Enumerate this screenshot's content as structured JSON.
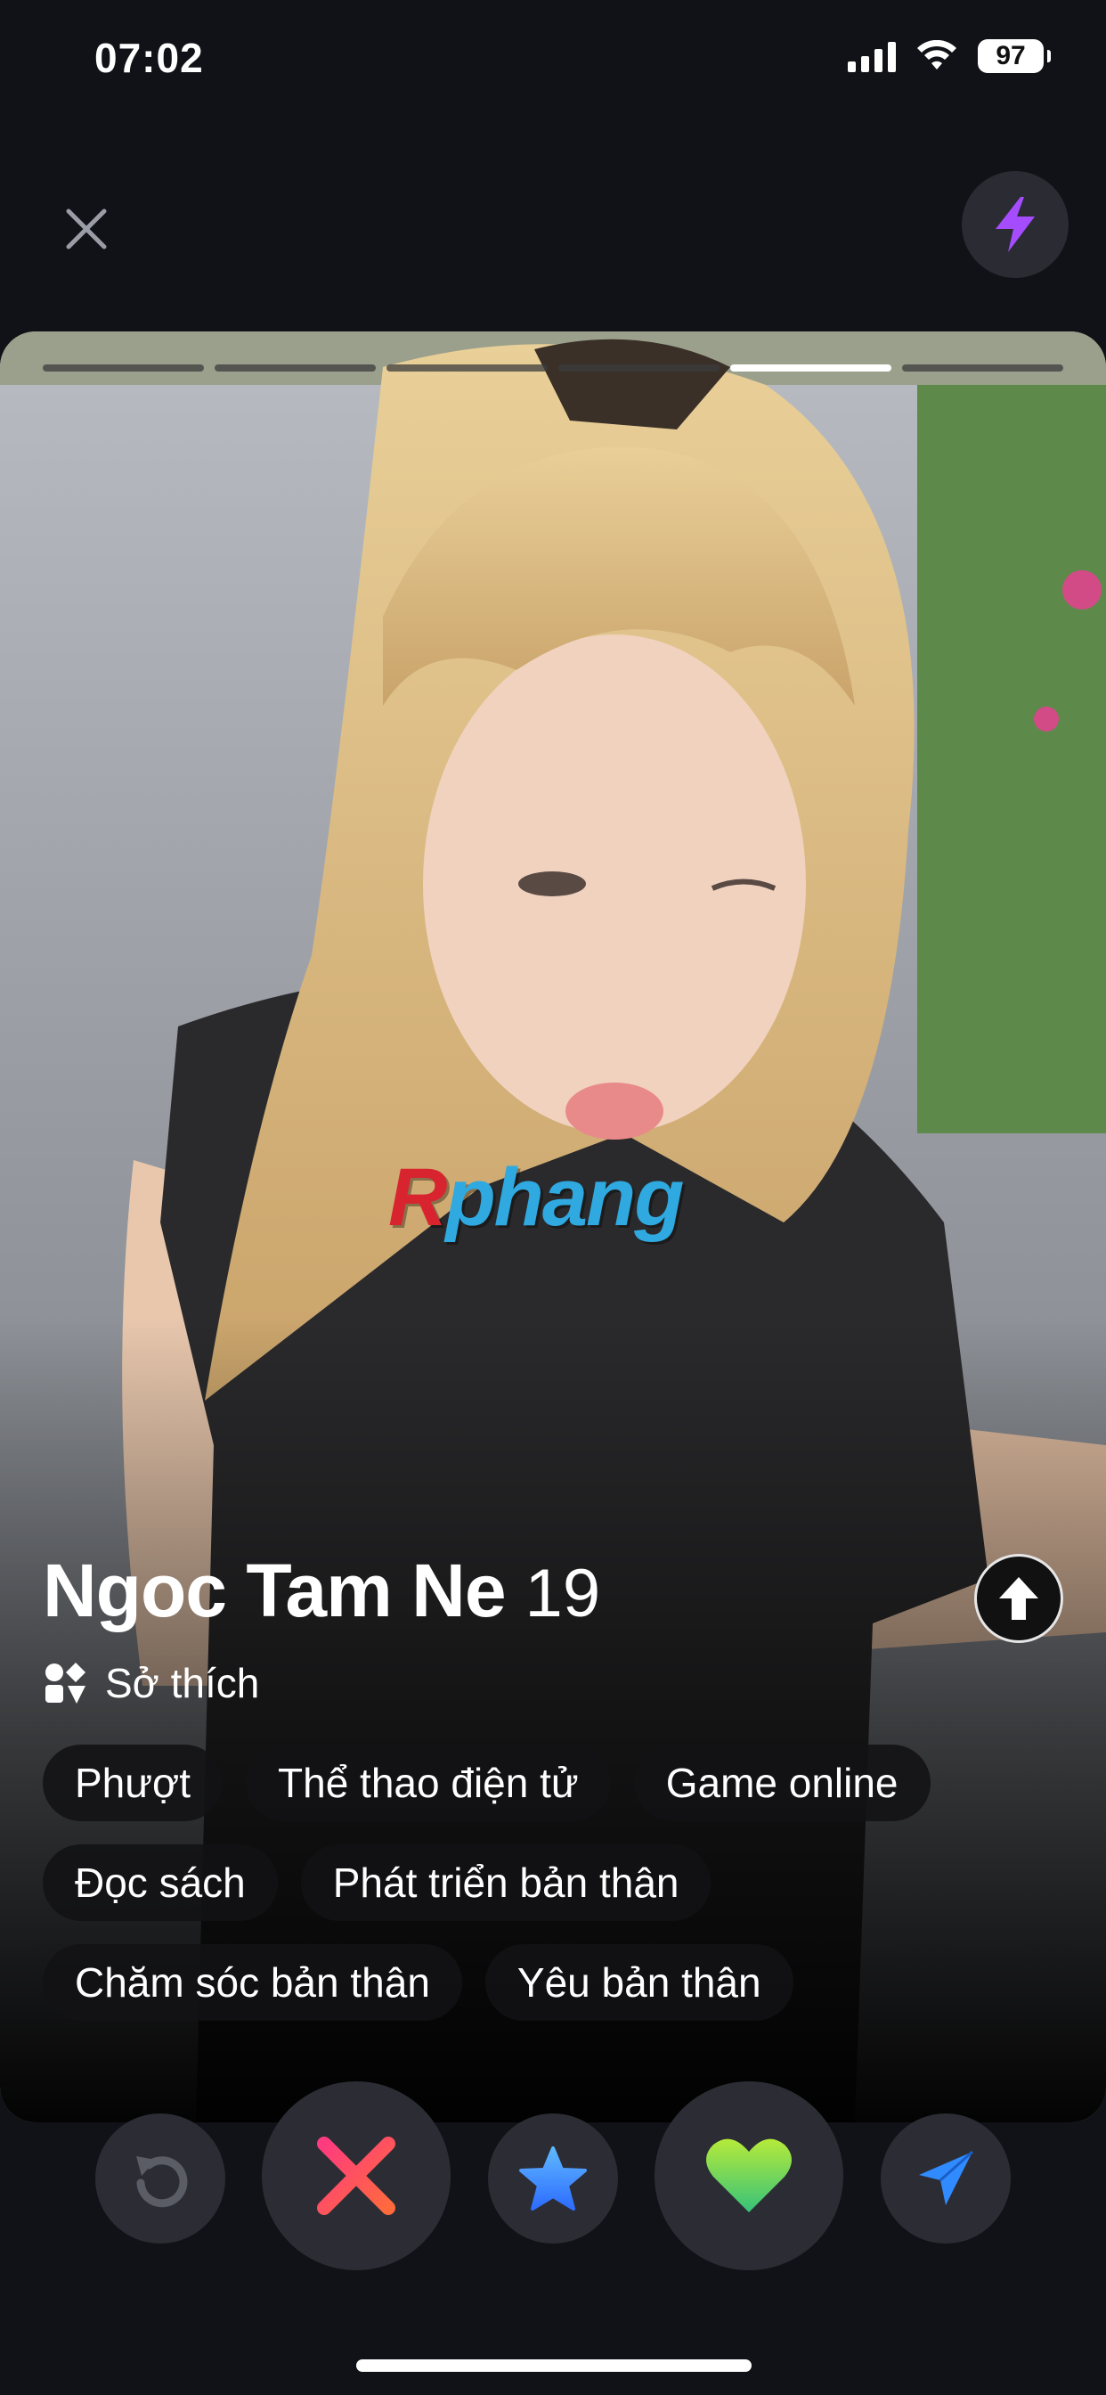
{
  "status_bar": {
    "time": "07:02",
    "battery": "97"
  },
  "profile": {
    "name": "Ngoc Tam Ne",
    "age": "19",
    "section_label": "Sở thích",
    "interests": [
      "Phượt",
      "Thể thao điện tử",
      "Game online",
      "Đọc sách",
      "Phát triển bản thân",
      "Chăm sóc bản thân",
      "Yêu bản thân"
    ],
    "photo_count": 6,
    "active_photo_index": 4
  },
  "watermark": {
    "prefix": "R",
    "text": "phang"
  },
  "icons": {
    "close": "close-icon",
    "boost": "lightning-bolt-icon",
    "info": "arrow-up-icon",
    "rewind": "rewind-icon",
    "nope": "x-icon",
    "super_like": "star-icon",
    "like": "heart-icon",
    "send": "paper-plane-icon"
  },
  "colors": {
    "background": "#111217",
    "boost": "#a64cff",
    "nope_start": "#ff3b7f",
    "nope_end": "#ff6a3d",
    "star": "#2d8cff",
    "heart_start": "#b6ea3a",
    "heart_end": "#35c27a",
    "send": "#2f8bff"
  }
}
